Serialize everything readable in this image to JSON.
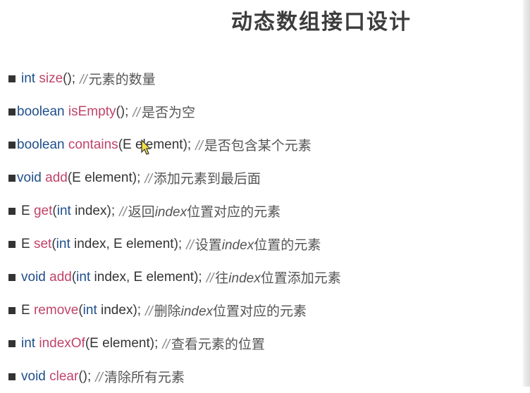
{
  "title": "动态数组接口设计",
  "methods": [
    {
      "ret": "int",
      "name": "size",
      "args": [],
      "comment": [
        "元素的数量"
      ]
    },
    {
      "ret": "boolean",
      "name": "isEmpty",
      "args": [],
      "comment": [
        "是否为空"
      ]
    },
    {
      "ret": "boolean",
      "name": "contains",
      "args": [
        {
          "type": "E",
          "name": "element"
        }
      ],
      "comment": [
        "是否包含某个元素"
      ]
    },
    {
      "ret": "void",
      "name": "add",
      "args": [
        {
          "type": "E",
          "name": "element"
        }
      ],
      "comment": [
        "添加元素到最后面"
      ]
    },
    {
      "ret": "E",
      "name": "get",
      "args": [
        {
          "type": "int",
          "name": "index"
        }
      ],
      "comment": [
        "返回",
        "index",
        "位置对应的元素"
      ]
    },
    {
      "ret": "E",
      "name": "set",
      "args": [
        {
          "type": "int",
          "name": "index"
        },
        {
          "type": "E",
          "name": "element"
        }
      ],
      "comment": [
        "设置",
        "index",
        "位置的元素"
      ]
    },
    {
      "ret": "void",
      "name": "add",
      "args": [
        {
          "type": "int",
          "name": "index"
        },
        {
          "type": "E",
          "name": "element"
        }
      ],
      "comment": [
        "往",
        "index",
        "位置添加元素"
      ]
    },
    {
      "ret": "E",
      "name": "remove",
      "args": [
        {
          "type": "int",
          "name": "index"
        }
      ],
      "comment": [
        "删除",
        "index",
        "位置对应的元素"
      ]
    },
    {
      "ret": "int",
      "name": "indexOf",
      "args": [
        {
          "type": "E",
          "name": "element"
        }
      ],
      "comment": [
        "查看元素的位置"
      ]
    },
    {
      "ret": "void",
      "name": "clear",
      "args": [],
      "comment": [
        "清除所有元素"
      ]
    }
  ],
  "colors": {
    "keyword": "#1f4e8c",
    "method_name": "#c0446a",
    "text": "#3a3a3a",
    "comment": "#555555"
  }
}
